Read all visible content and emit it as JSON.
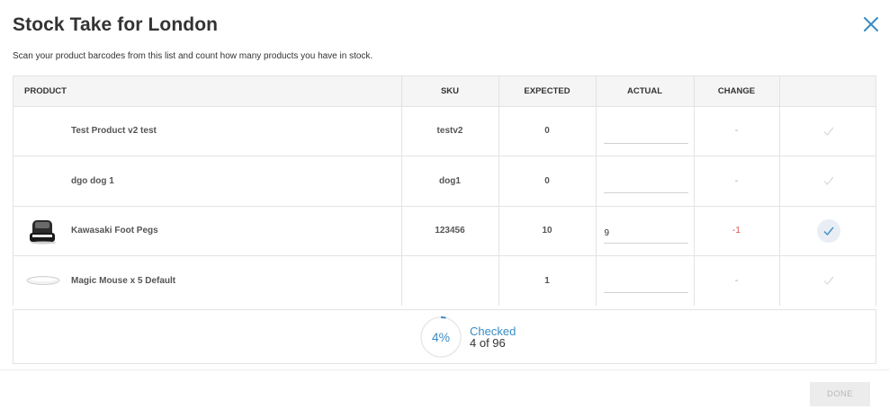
{
  "header": {
    "title": "Stock Take for London",
    "subtitle": "Scan your product barcodes from this list and count how many products you have in stock."
  },
  "table": {
    "columns": [
      "PRODUCT",
      "SKU",
      "EXPECTED",
      "ACTUAL",
      "CHANGE",
      ""
    ],
    "rows": [
      {
        "product": "Test Product v2 test",
        "thumb": "none",
        "sku": "testv2",
        "expected": "0",
        "actual": "",
        "change": "-",
        "checked": false
      },
      {
        "product": "dgo dog 1",
        "thumb": "none",
        "sku": "dog1",
        "expected": "0",
        "actual": "",
        "change": "-",
        "checked": false
      },
      {
        "product": "Kawasaki Foot Pegs",
        "thumb": "label-printer-image",
        "sku": "123456",
        "expected": "10",
        "actual": "9",
        "change": "-1",
        "checked": true
      },
      {
        "product": "Magic Mouse x 5 Default",
        "thumb": "mouse-image",
        "sku": "",
        "expected": "1",
        "actual": "",
        "change": "-",
        "checked": false
      }
    ]
  },
  "progress": {
    "percent_label": "4%",
    "percent_value": 4,
    "label": "Checked",
    "count": "4 of 96"
  },
  "footer": {
    "done_label": "DONE"
  },
  "colors": {
    "accent": "#3a8dc4",
    "negative": "#d9534f",
    "border": "#e3e3e3"
  }
}
